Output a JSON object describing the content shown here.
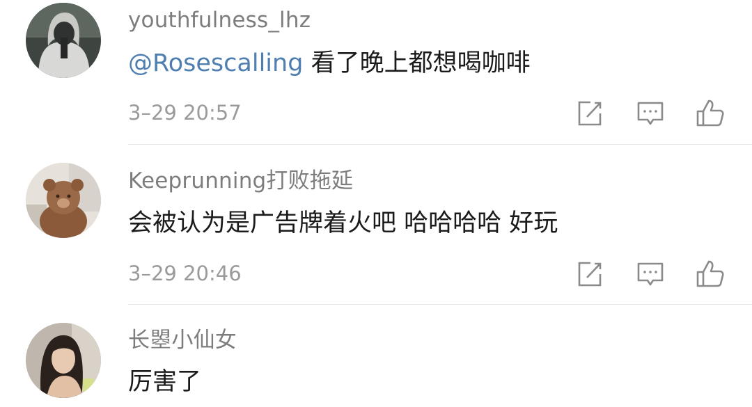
{
  "comments": [
    {
      "username": "youthfulness_lhz",
      "mention": "@Rosescalling",
      "text": " 看了晚上都想喝咖啡",
      "time": "3–29 20:57"
    },
    {
      "username": "Keeprunning打败拖延",
      "mention": "",
      "text": "会被认为是广告牌着火吧 哈哈哈哈 好玩",
      "time": "3–29 20:46"
    },
    {
      "username": "长曌小仙女",
      "mention": "",
      "text": "厉害了",
      "time": ""
    }
  ],
  "colors": {
    "username": "#7d7d7d",
    "mention": "#4f7fb0",
    "time": "#9a9a9a",
    "icon": "#8a8a8a",
    "divider": "#e6e6e6"
  },
  "icons": [
    "share-icon",
    "reply-icon",
    "like-icon"
  ]
}
